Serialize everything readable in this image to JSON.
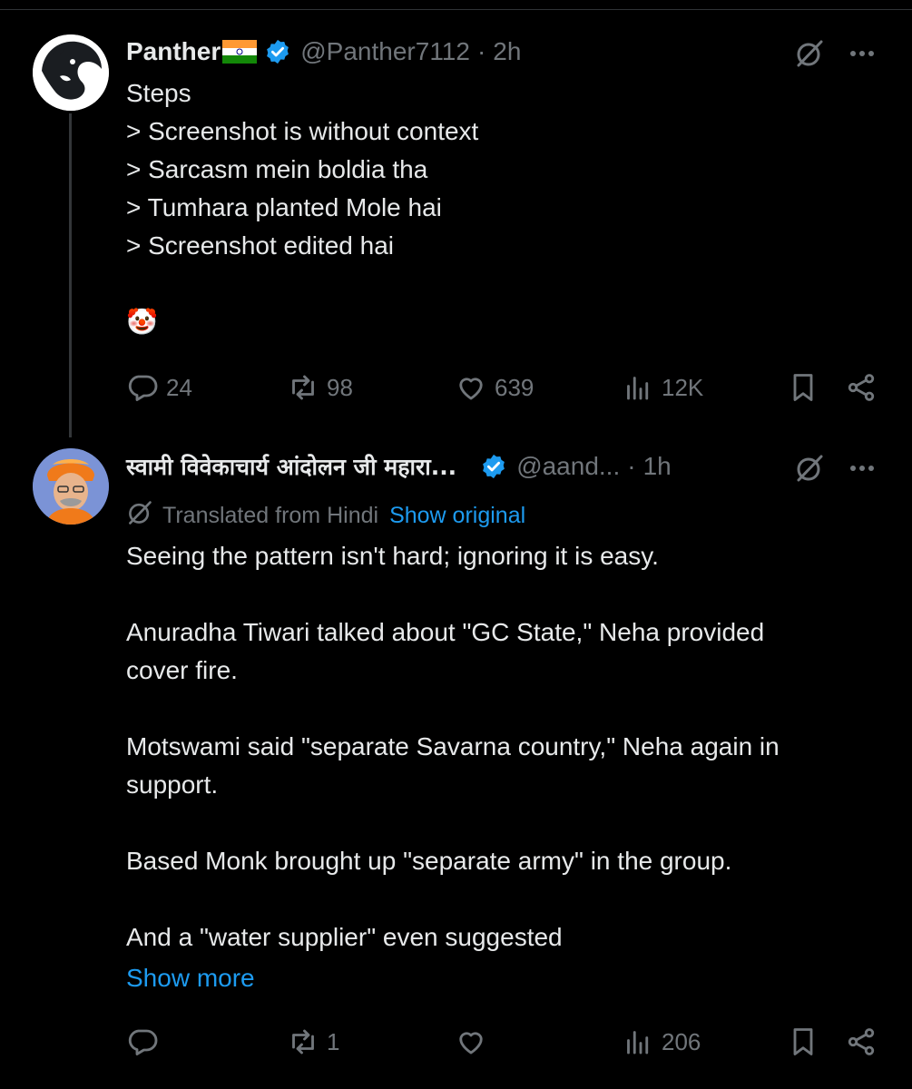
{
  "tweets": [
    {
      "name": "Panther",
      "flag": "india-flag",
      "handle": "@Panther7112",
      "dot": "·",
      "time": "2h",
      "body": "Steps\n> Screenshot is without context\n> Sarcasm mein boldia tha\n> Tumhara planted Mole hai\n> Screenshot edited hai\n\n🤡",
      "stats": {
        "replies": "24",
        "reposts": "98",
        "likes": "639",
        "views": "12K"
      }
    },
    {
      "name": "स्वामी विवेकाचार्य आंदोलन जी महारा...",
      "handle": "@aand...",
      "dot": "·",
      "time": "1h",
      "translated_label": "Translated from Hindi",
      "show_original": "Show original",
      "body": "Seeing the pattern isn't hard; ignoring it is easy.\n\nAnuradha Tiwari talked about \"GC State,\" Neha provided\ncover fire.\n\nMotswami said \"separate Savarna country,\" Neha again in\nsupport.\n\nBased Monk brought up \"separate army\" in the group.\n\nAnd a \"water supplier\" even suggested",
      "show_more": "Show more",
      "stats": {
        "replies": "",
        "reposts": "1",
        "likes": "",
        "views": "206"
      }
    }
  ],
  "colors": {
    "background": "#000000",
    "text": "#e7e9ea",
    "muted": "#71767b",
    "link": "#1d9bf0",
    "verified": "#1d9bf0"
  }
}
